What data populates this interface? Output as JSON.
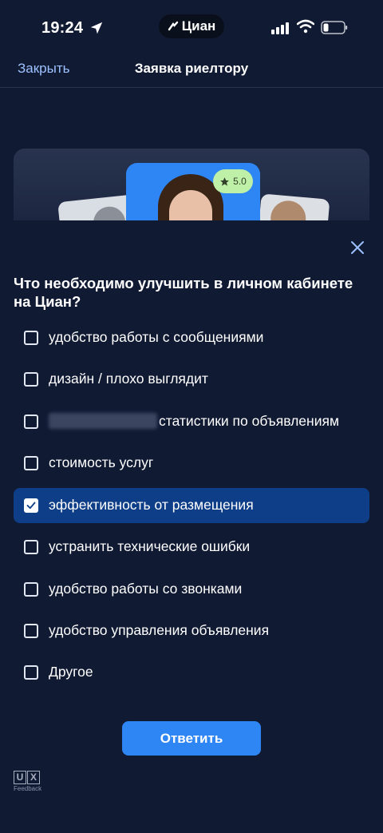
{
  "status_bar": {
    "time": "19:24",
    "app_name": "Циан"
  },
  "nav": {
    "close_label": "Закрыть",
    "title": "Заявка риелтору"
  },
  "banner": {
    "rating": "5.0"
  },
  "survey": {
    "question": "Что необходимо улучшить в личном кабинете на Циан?",
    "options": [
      {
        "label": "удобство работы с сообщениями",
        "checked": false
      },
      {
        "label": "дизайн / плохо выглядит",
        "checked": false
      },
      {
        "label": "статистики по объявлениям",
        "checked": false,
        "partially_obscured": true
      },
      {
        "label": "стоимость услуг",
        "checked": false
      },
      {
        "label": "эффективность от размещения",
        "checked": true
      },
      {
        "label": "устранить технические ошибки",
        "checked": false
      },
      {
        "label": "удобство работы со звонками",
        "checked": false
      },
      {
        "label": "удобство управления объявления",
        "checked": false
      },
      {
        "label": "Другое",
        "checked": false
      }
    ],
    "submit_label": "Ответить"
  },
  "branding": {
    "ux_letters": [
      "U",
      "X"
    ],
    "caption": "Feedback"
  },
  "colors": {
    "background": "#101a33",
    "accent": "#2e86f5",
    "selected_row": "#0e3e88",
    "link": "#9ec1ff",
    "rating_badge": "#bff0a8"
  }
}
